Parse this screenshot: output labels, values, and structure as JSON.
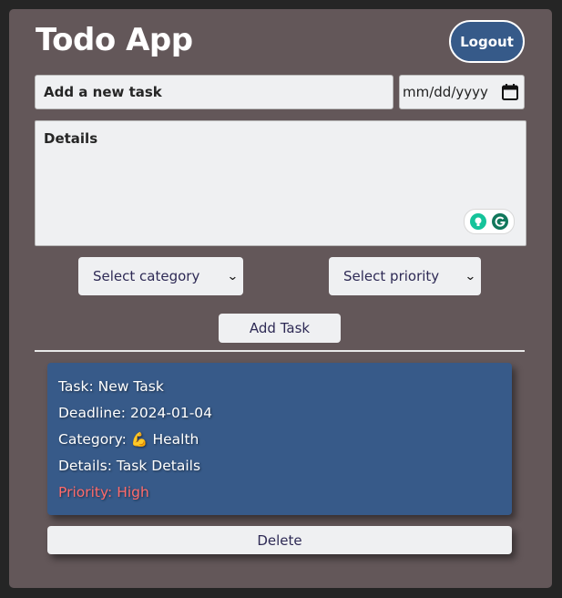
{
  "header": {
    "title": "Todo App",
    "logout_label": "Logout"
  },
  "form": {
    "task_placeholder": "Add a new task",
    "date_placeholder": "mm/dd/yyyy",
    "details_placeholder": "Details",
    "category_select": {
      "selected": "Select category",
      "options": [
        "Select category"
      ]
    },
    "priority_select": {
      "selected": "Select priority",
      "options": [
        "Select priority"
      ]
    },
    "add_label": "Add Task"
  },
  "tasks": [
    {
      "task_label": "Task:",
      "task_value": "New Task",
      "deadline_label": "Deadline:",
      "deadline_value": "2024-01-04",
      "category_label": "Category:",
      "category_emoji": "💪",
      "category_value": "Health",
      "details_label": "Details:",
      "details_value": "Task Details",
      "priority_label": "Priority:",
      "priority_value": "High",
      "delete_label": "Delete"
    }
  ],
  "colors": {
    "page_bg": "#252525",
    "card_bg": "#635759",
    "accent": "#375a89",
    "priority_high": "#ff6b6b",
    "field_bg": "#eff0f2"
  },
  "icons": {
    "date": "calendar-icon",
    "grammarly_suggest": "lightbulb-icon",
    "grammarly": "grammarly-icon",
    "select_arrow": "chevron-down-icon"
  }
}
